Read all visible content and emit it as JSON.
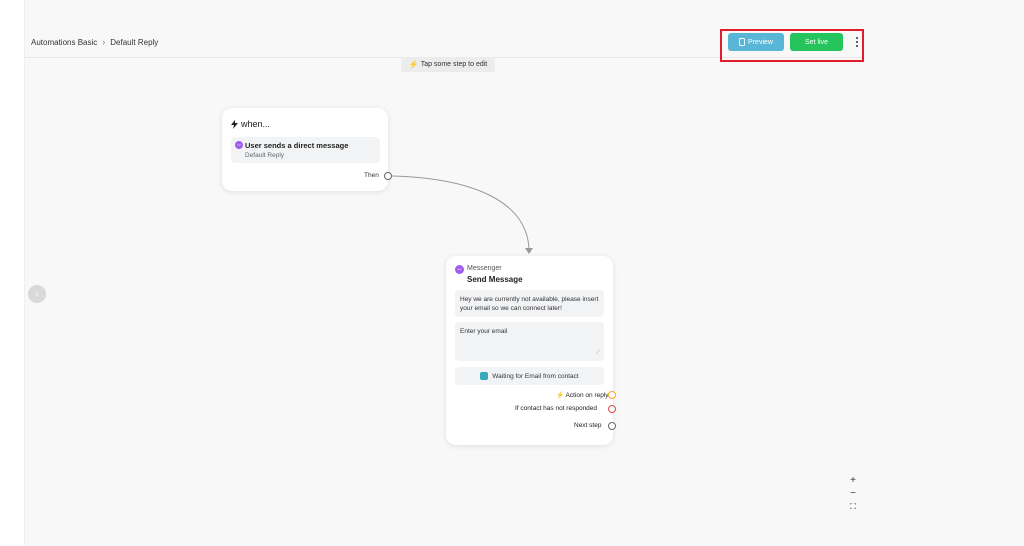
{
  "breadcrumb": {
    "root": "Automations Basic",
    "current": "Default Reply"
  },
  "hint": "Tap some step to edit",
  "toolbar": {
    "preview_label": "Preview",
    "setlive_label": "Set live"
  },
  "trigger": {
    "title": "when...",
    "event_title": "User sends a direct message",
    "event_sub": "Default Reply",
    "then_label": "Then"
  },
  "message_step": {
    "channel": "Messenger",
    "title": "Send Message",
    "text": "Hey we are currently not available, please insert your email so we can connect later!",
    "input_placeholder": "Enter your email",
    "waiting": "Waiting for Email from contact",
    "outputs": {
      "action_on_reply": "Action on reply",
      "not_responded": "If contact has not responded",
      "next_step": "Next step"
    }
  },
  "zoom": {
    "in": "+",
    "out": "−",
    "fit": "⛶"
  },
  "colors": {
    "preview": "#5ab6d6",
    "setlive": "#25c45c",
    "highlight": "#e11d2e",
    "reply_port": "#f5a623",
    "noresponse_port": "#e04848"
  },
  "icons": {
    "bolt": "bolt-icon",
    "messenger": "messenger-icon",
    "kebab": "kebab-menu-icon",
    "chevron": "chevron-right-icon"
  }
}
